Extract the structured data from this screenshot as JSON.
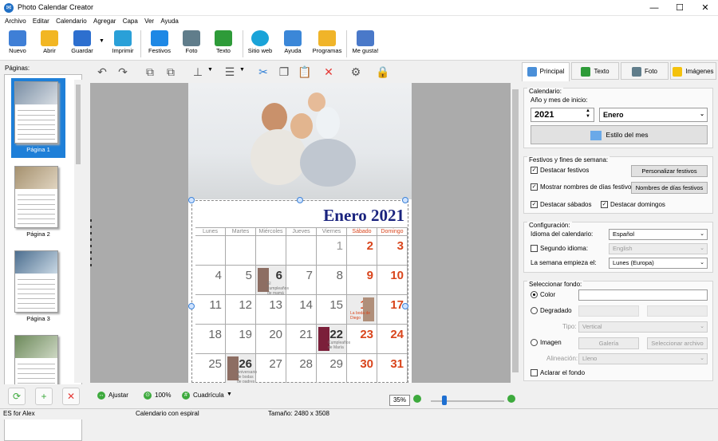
{
  "window": {
    "title": "Photo Calendar Creator"
  },
  "menu": [
    "Archivo",
    "Editar",
    "Calendario",
    "Agregar",
    "Capa",
    "Ver",
    "Ayuda"
  ],
  "toolbar": [
    {
      "label": "Nuevo",
      "icon": "new-icon",
      "color": "#3f7fd6"
    },
    {
      "label": "Abrir",
      "icon": "folder-open-icon",
      "color": "#f2b623"
    },
    {
      "label": "Guardar",
      "icon": "save-disk-icon",
      "color": "#2d6fcf"
    },
    {
      "label": "Imprimir",
      "icon": "printer-icon",
      "color": "#2aa0d8"
    },
    {
      "label": "Festivos",
      "icon": "calendar-holiday-icon",
      "color": "#1e88e5"
    },
    {
      "label": "Foto",
      "icon": "camera-icon",
      "color": "#607d8b"
    },
    {
      "label": "Texto",
      "icon": "text-a-icon",
      "color": "#2e9b39"
    },
    {
      "label": "Sitio web",
      "icon": "globe-icon",
      "color": "#1aa3d8"
    },
    {
      "label": "Ayuda",
      "icon": "help-book-icon",
      "color": "#3b87d8"
    },
    {
      "label": "Programas",
      "icon": "gift-box-icon",
      "color": "#f0b429"
    },
    {
      "label": "Me gusta!",
      "icon": "thumbs-up-icon",
      "color": "#4a79c9"
    }
  ],
  "pages_panel": {
    "label": "Páginas:",
    "thumbnails": [
      "Página 1",
      "Página 2",
      "Página 3",
      ""
    ]
  },
  "calendar": {
    "month_title": "Enero 2021",
    "weekdays": [
      "Lunes",
      "Martes",
      "Miércoles",
      "Jueves",
      "Viernes",
      "Sábado",
      "Domingo"
    ],
    "notes": {
      "d6": "El cumpleaños de mamá",
      "d16": "La boda de Diego",
      "d22": "Cumpleaños de María",
      "d26": "Aniversario de bodas de padres"
    }
  },
  "bottom": {
    "fit": "Ajustar",
    "zoom100": "100%",
    "grid": "Cuadrícula",
    "zoom_value": "35%"
  },
  "status": {
    "lang": "ES for Alex",
    "type": "Calendario con espiral",
    "size": "Tamaño: 2480 x 3508"
  },
  "right_tabs": [
    "Principal",
    "Texto",
    "Foto",
    "Imágenes"
  ],
  "calendar_group": {
    "title": "Calendario:",
    "start_label": "Año y mes de inicio:",
    "year": "2021",
    "month": "Enero",
    "style_button": "Estilo del mes"
  },
  "holidays_group": {
    "title": "Festivos y fines de semana:",
    "highlight_holidays": "Destacar festivos",
    "customize_holidays": "Personalizar festivos",
    "show_names": "Mostrar nombres de días festivos",
    "holiday_names_btn": "Nombres de días festivos",
    "highlight_saturdays": "Destacar sábados",
    "highlight_sundays": "Destacar domingos"
  },
  "config_group": {
    "title": "Configuración:",
    "lang_label": "Idioma del calendario:",
    "lang_value": "Español",
    "second_lang_label": "Segundo idioma:",
    "second_lang_value": "English",
    "week_start_label": "La semana empieza el:",
    "week_start_value": "Lunes (Europa)"
  },
  "background_group": {
    "title": "Seleccionar fondo:",
    "color": "Color",
    "gradient": "Degradado",
    "type_label": "Tipo:",
    "type_value": "Vertical",
    "image": "Imagen",
    "gallery": "Galería",
    "select_file": "Seleccionar archivo",
    "align_label": "Alineación:",
    "align_value": "Lleno",
    "lighten": "Aclarar el fondo"
  }
}
